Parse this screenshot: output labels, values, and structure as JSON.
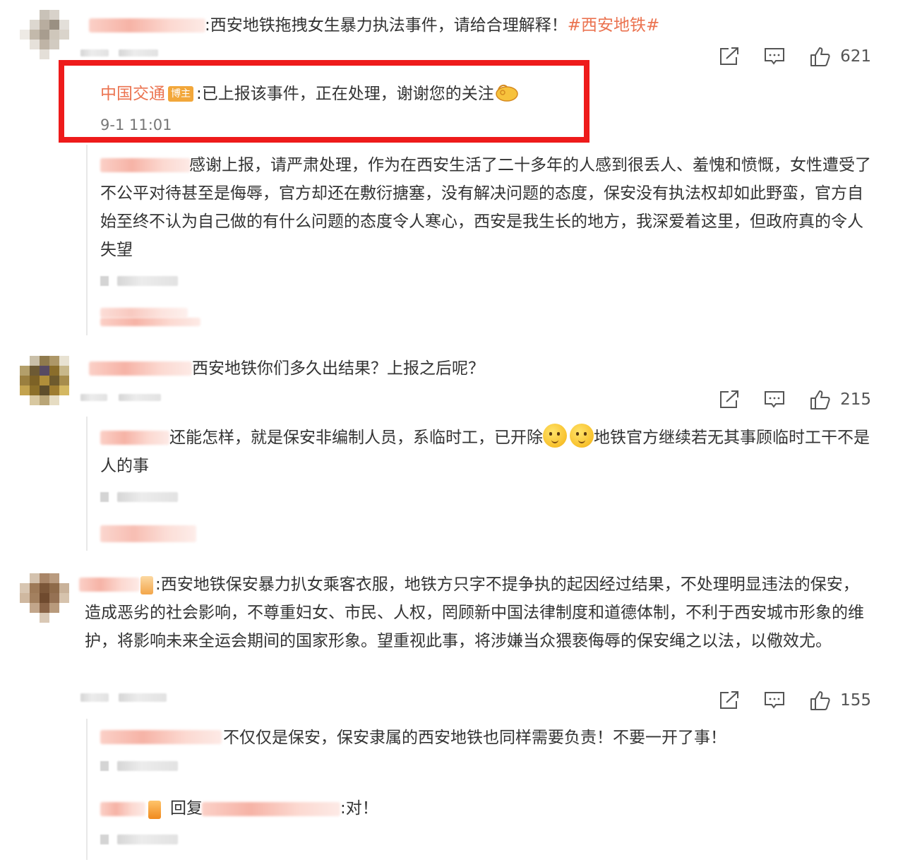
{
  "colors": {
    "accent": "#eb7350",
    "highlight": "#ee1b1b",
    "badge": "#f2a73a"
  },
  "comments": [
    {
      "text": ":西安地铁拖拽女生暴力执法事件，请给合理解释！",
      "hashtag": "#西安地铁#",
      "likes": "621",
      "pinned_reply": {
        "name": "中国交通",
        "badge": "博主",
        "text": ":已上报该事件，正在处理，谢谢您的关注",
        "emoji": "ok-hand-icon",
        "time": "9-1 11:01"
      },
      "replies": [
        {
          "text": "感谢上报，请严肃处理，作为在西安生活了二十多年的人感到很丢人、羞愧和愤慨，女性遭受了不公平对待甚至是侮辱，官方却还在敷衍搪塞，没有解决问题的态度，保安没有执法权却如此野蛮，官方自始至终不认为自己做的有什么问题的态度令人寒心，西安是我生长的地方，我深爱着这里，但政府真的令人失望"
        }
      ]
    },
    {
      "text": "西安地铁你们多久出结果？上报之后呢？",
      "likes": "215",
      "replies": [
        {
          "text_a": "还能怎样，就是保安非编制人员，系临时工，已开除",
          "text_b": "地铁官方继续若无其事顾临时工干不是人的事"
        }
      ]
    },
    {
      "text": ":西安地铁保安暴力扒女乘客衣服，地铁方只字不提争执的起因经过结果，不处理明显违法的保安，造成恶劣的社会影响，不尊重妇女、市民、人权，罔顾新中国法律制度和道德体制，不利于西安城市形象的维护，将影响未来全运会期间的国家形象。望重视此事，将涉嫌当众猥亵侮辱的保安绳之以法，以儆效尤。",
      "likes": "155",
      "replies": [
        {
          "text": "不仅仅是保安，保安隶属的西安地铁也同样需要负责！不要一开了事！"
        },
        {
          "prefix": "回复",
          "text": ":对！"
        }
      ]
    }
  ],
  "icons": {
    "share": "share-icon",
    "comment": "comment-icon",
    "like": "thumbs-up-icon"
  }
}
